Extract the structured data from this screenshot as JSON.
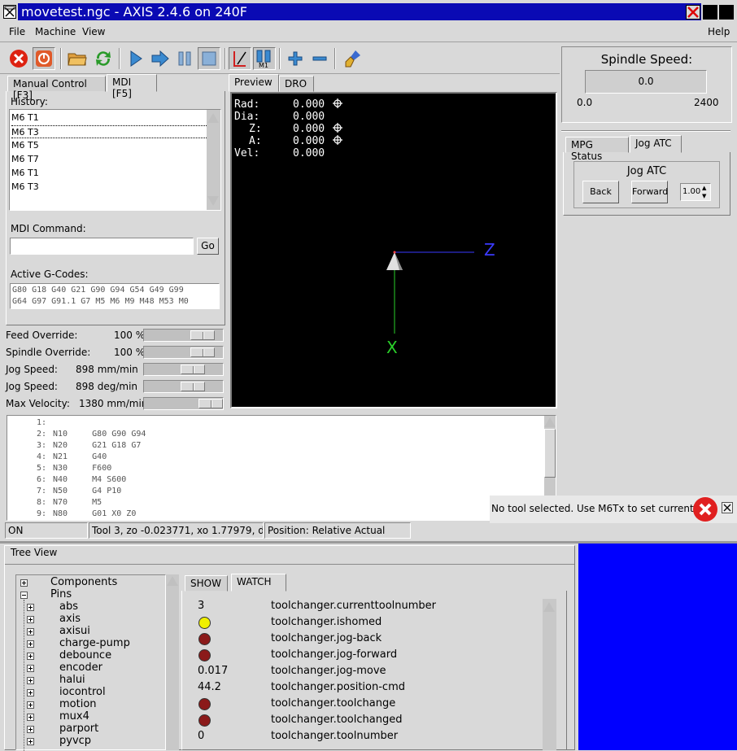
{
  "window": {
    "title": "movetest.ngc - AXIS 2.4.6 on 240F"
  },
  "menubar": {
    "file": "File",
    "machine": "Machine",
    "view": "View",
    "help": "Help"
  },
  "toolbar": {
    "icons": [
      "estop-icon",
      "machine-power-icon",
      "open-file-icon",
      "reload-icon",
      "run-icon",
      "step-icon",
      "pause-icon",
      "stop-icon",
      "block-delete-icon",
      "optional-stop-icon",
      "zoom-in-icon",
      "zoom-out-icon",
      "clear-plot-icon"
    ]
  },
  "left_tabs": {
    "manual": "Manual Control [F3]",
    "mdi": "MDI [F5]"
  },
  "mdi": {
    "history_label": "History:",
    "history": [
      "M6 T1",
      "M6 T3",
      "M6 T5",
      "M6 T7",
      "M6 T1",
      "M6 T3"
    ],
    "command_label": "MDI Command:",
    "command_value": "",
    "go": "Go",
    "gcodes_label": "Active G-Codes:",
    "gcodes_line1": "G80 G18 G40 G21 G90 G94 G54 G49 G99",
    "gcodes_line2": "G64 G97 G91.1 G7 M5 M6 M9 M48 M53 M0"
  },
  "overrides": {
    "feed_label": "Feed Override:",
    "feed_value": "100 %",
    "spindle_label": "Spindle Override:",
    "spindle_value": "100 %",
    "jog1_label": "Jog Speed:",
    "jog1_value": "898 mm/min",
    "jog2_label": "Jog Speed:",
    "jog2_value": "898 deg/min",
    "maxvel_label": "Max Velocity:",
    "maxvel_value": "1380 mm/min"
  },
  "center_tabs": {
    "preview": "Preview",
    "dro": "DRO"
  },
  "dro": {
    "rad_label": "Rad:",
    "rad_value": "0.000",
    "dia_label": "Dia:",
    "dia_value": "0.000",
    "z_label": "Z:",
    "z_value": "0.000",
    "a_label": "A:",
    "a_value": "0.000",
    "vel_label": "Vel:",
    "vel_value": "0.000",
    "axis_z": "Z",
    "axis_x": "X"
  },
  "gcode_lines": [
    {
      "num": "1:",
      "text": ""
    },
    {
      "num": "2:",
      "text": "N10     G80 G90 G94"
    },
    {
      "num": "3:",
      "text": "N20     G21 G18 G7"
    },
    {
      "num": "4:",
      "text": "N21     G40"
    },
    {
      "num": "5:",
      "text": "N30     F600"
    },
    {
      "num": "6:",
      "text": "N40     M4 S600"
    },
    {
      "num": "7:",
      "text": "N50     G4 P10"
    },
    {
      "num": "8:",
      "text": "N70     M5"
    },
    {
      "num": "9:",
      "text": "N80     G01 X0 Z0"
    }
  ],
  "notification": {
    "text": "No tool selected. Use M6Tx to set current tool"
  },
  "statusbar": {
    "state": "ON",
    "tool": "Tool 3, zo -0.023771, xo 1.77979, dia 0",
    "position": "Position: Relative Actual"
  },
  "spindle": {
    "title": "Spindle Speed:",
    "value": "0.0",
    "min": "0.0",
    "max": "2400"
  },
  "right_tabs": {
    "mpg": "MPG Status",
    "jog_atc": "Jog ATC"
  },
  "jog_atc": {
    "title": "Jog ATC",
    "back": "Back",
    "forward": "Forward",
    "step": "1.00"
  },
  "tree_view": {
    "title": "Tree View",
    "items": [
      {
        "label": "Components",
        "level": 0,
        "expanded": false
      },
      {
        "label": "Pins",
        "level": 0,
        "expanded": true
      },
      {
        "label": "abs",
        "level": 1
      },
      {
        "label": "axis",
        "level": 1
      },
      {
        "label": "axisui",
        "level": 1
      },
      {
        "label": "charge-pump",
        "level": 1
      },
      {
        "label": "debounce",
        "level": 1
      },
      {
        "label": "encoder",
        "level": 1
      },
      {
        "label": "halui",
        "level": 1
      },
      {
        "label": "iocontrol",
        "level": 1
      },
      {
        "label": "motion",
        "level": 1
      },
      {
        "label": "mux4",
        "level": 1
      },
      {
        "label": "parport",
        "level": 1
      },
      {
        "label": "pyvcp",
        "level": 1
      }
    ]
  },
  "watch_tabs": {
    "show": "SHOW",
    "watch": "WATCH"
  },
  "watch": [
    {
      "value": "3",
      "name": "toolchanger.currenttoolnumber"
    },
    {
      "led": "#f0f000",
      "name": "toolchanger.ishomed"
    },
    {
      "led": "#8b1a1a",
      "name": "toolchanger.jog-back"
    },
    {
      "led": "#8b1a1a",
      "name": "toolchanger.jog-forward"
    },
    {
      "value": "0.017",
      "name": "toolchanger.jog-move"
    },
    {
      "value": "44.2",
      "name": "toolchanger.position-cmd"
    },
    {
      "led": "#8b1a1a",
      "name": "toolchanger.toolchange"
    },
    {
      "led": "#8b1a1a",
      "name": "toolchanger.toolchanged"
    },
    {
      "value": "0",
      "name": "toolchanger.toolnumber"
    }
  ],
  "colors": {
    "titlebar": "#0a0ab4",
    "preview_bg": "#000000",
    "blue_panel": "#0000ff"
  }
}
